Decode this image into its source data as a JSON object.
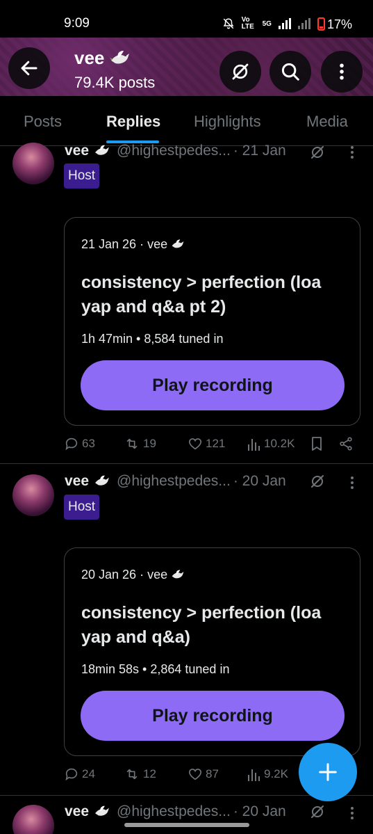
{
  "status_bar": {
    "time": "9:09",
    "network_label": "Vo LTE",
    "signal_label": "5G",
    "battery": "17%"
  },
  "header": {
    "name": "vee",
    "posts_count": "79.4K posts",
    "icons": [
      "back-arrow-icon",
      "grok-icon",
      "search-icon",
      "more-vert-icon"
    ]
  },
  "tabs": [
    {
      "label": "Posts",
      "active": false
    },
    {
      "label": "Replies",
      "active": true
    },
    {
      "label": "Highlights",
      "active": false
    },
    {
      "label": "Media",
      "active": false
    }
  ],
  "posts": [
    {
      "name": "vee",
      "handle": "@highestpedes...",
      "date": "· 21 Jan",
      "badge": "Host",
      "card": {
        "meta": "21 Jan 26 · vee",
        "title": "consistency > perfection (loa yap and q&a pt 2)",
        "stats": "1h 47min • 8,584 tuned in",
        "button": "Play recording"
      },
      "actions": {
        "replies": "63",
        "reposts": "19",
        "likes": "121",
        "views": "10.2K"
      }
    },
    {
      "name": "vee",
      "handle": "@highestpedes...",
      "date": "· 20 Jan",
      "badge": "Host",
      "card": {
        "meta": "20 Jan 26 · vee",
        "title": "consistency > perfection (loa yap and q&a)",
        "stats": "18min 58s • 2,864 tuned in",
        "button": "Play recording"
      },
      "actions": {
        "replies": "24",
        "reposts": "12",
        "likes": "87",
        "views": "9.2K"
      }
    },
    {
      "name": "vee",
      "handle": "@highestpedes...",
      "date": "· 20 Jan"
    }
  ],
  "colors": {
    "accent": "#1d9bf0",
    "play_button": "#8e6bf5",
    "host_badge": "#3b1d8f"
  }
}
